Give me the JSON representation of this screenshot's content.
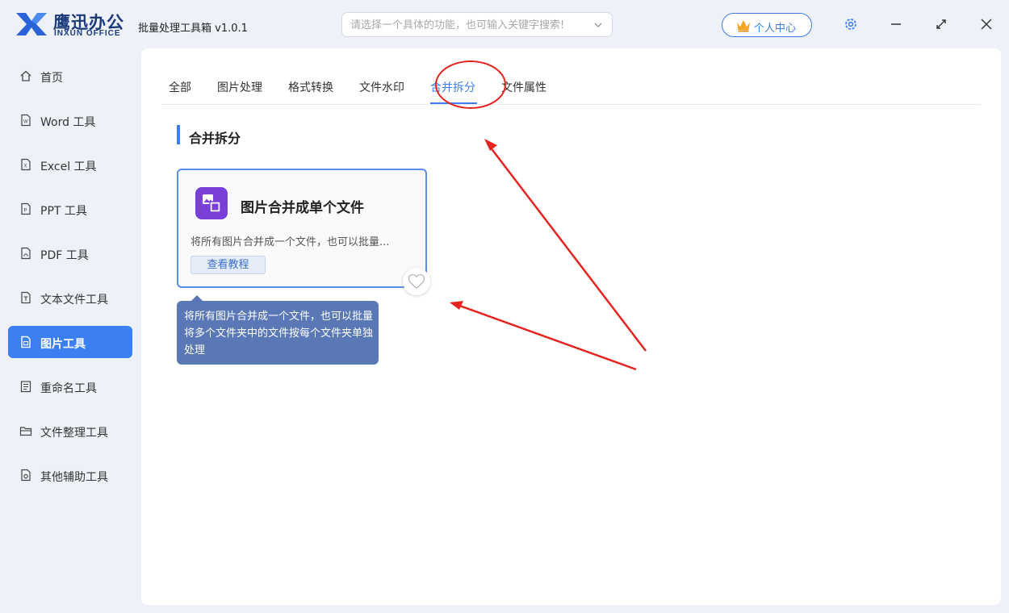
{
  "app": {
    "brand_cn": "鹰迅办公",
    "brand_en": "INXUN OFFICE",
    "title": "批量处理工具箱 v1.0.1",
    "search_placeholder": "请选择一个具体的功能，也可输入关键字搜索!",
    "user_center": "个人中心"
  },
  "sidebar": {
    "items": [
      {
        "label": "首页",
        "icon": "home-icon"
      },
      {
        "label": "Word 工具",
        "icon": "word-file-icon"
      },
      {
        "label": "Excel 工具",
        "icon": "excel-file-icon"
      },
      {
        "label": "PPT 工具",
        "icon": "ppt-file-icon"
      },
      {
        "label": "PDF 工具",
        "icon": "pdf-file-icon"
      },
      {
        "label": "文本文件工具",
        "icon": "text-file-icon"
      },
      {
        "label": "图片工具",
        "icon": "image-file-icon",
        "active": true
      },
      {
        "label": "重命名工具",
        "icon": "rename-icon"
      },
      {
        "label": "文件整理工具",
        "icon": "folder-icon"
      },
      {
        "label": "其他辅助工具",
        "icon": "misc-tool-icon"
      }
    ]
  },
  "tabs": [
    {
      "label": "全部"
    },
    {
      "label": "图片处理"
    },
    {
      "label": "格式转换"
    },
    {
      "label": "文件水印"
    },
    {
      "label": "合并拆分",
      "active": true
    },
    {
      "label": "文件属性"
    }
  ],
  "section": {
    "title": "合并拆分"
  },
  "card": {
    "title": "图片合并成单个文件",
    "description": "将所有图片合并成一个文件，也可以批量...",
    "tutorial_label": "查看教程"
  },
  "tooltip": {
    "text": "将所有图片合并成一个文件，也可以批量将多个文件夹中的文件按每个文件夹单独处理"
  },
  "colors": {
    "accent": "#3b7ff1",
    "annotation": "#e52420",
    "tooltip_bg": "#5a78b6",
    "app_icon_bg": "#7a3fd6"
  }
}
